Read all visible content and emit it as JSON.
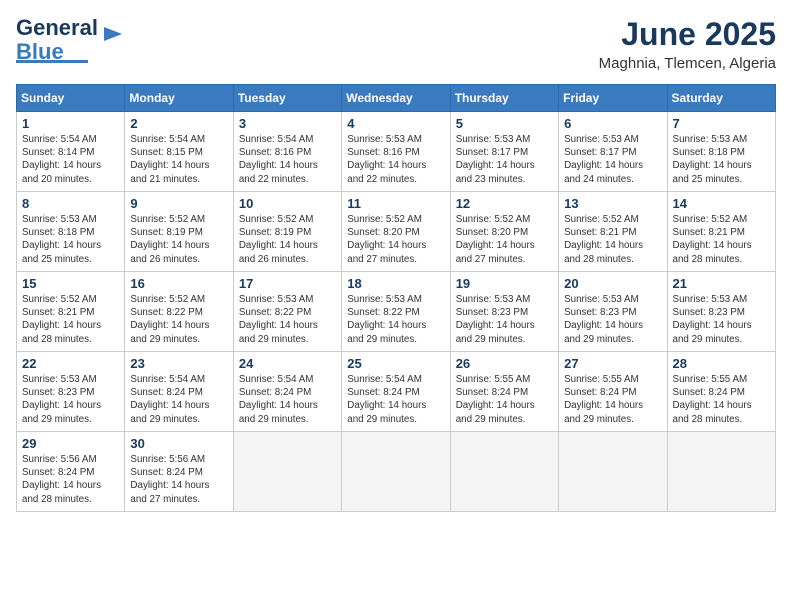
{
  "logo": {
    "line1": "General",
    "line2": "Blue"
  },
  "title": "June 2025",
  "location": "Maghnia, Tlemcen, Algeria",
  "headers": [
    "Sunday",
    "Monday",
    "Tuesday",
    "Wednesday",
    "Thursday",
    "Friday",
    "Saturday"
  ],
  "weeks": [
    [
      {
        "day": "1",
        "lines": [
          "Sunrise: 5:54 AM",
          "Sunset: 8:14 PM",
          "Daylight: 14 hours",
          "and 20 minutes."
        ]
      },
      {
        "day": "2",
        "lines": [
          "Sunrise: 5:54 AM",
          "Sunset: 8:15 PM",
          "Daylight: 14 hours",
          "and 21 minutes."
        ]
      },
      {
        "day": "3",
        "lines": [
          "Sunrise: 5:54 AM",
          "Sunset: 8:16 PM",
          "Daylight: 14 hours",
          "and 22 minutes."
        ]
      },
      {
        "day": "4",
        "lines": [
          "Sunrise: 5:53 AM",
          "Sunset: 8:16 PM",
          "Daylight: 14 hours",
          "and 22 minutes."
        ]
      },
      {
        "day": "5",
        "lines": [
          "Sunrise: 5:53 AM",
          "Sunset: 8:17 PM",
          "Daylight: 14 hours",
          "and 23 minutes."
        ]
      },
      {
        "day": "6",
        "lines": [
          "Sunrise: 5:53 AM",
          "Sunset: 8:17 PM",
          "Daylight: 14 hours",
          "and 24 minutes."
        ]
      },
      {
        "day": "7",
        "lines": [
          "Sunrise: 5:53 AM",
          "Sunset: 8:18 PM",
          "Daylight: 14 hours",
          "and 25 minutes."
        ]
      }
    ],
    [
      {
        "day": "8",
        "lines": [
          "Sunrise: 5:53 AM",
          "Sunset: 8:18 PM",
          "Daylight: 14 hours",
          "and 25 minutes."
        ]
      },
      {
        "day": "9",
        "lines": [
          "Sunrise: 5:52 AM",
          "Sunset: 8:19 PM",
          "Daylight: 14 hours",
          "and 26 minutes."
        ]
      },
      {
        "day": "10",
        "lines": [
          "Sunrise: 5:52 AM",
          "Sunset: 8:19 PM",
          "Daylight: 14 hours",
          "and 26 minutes."
        ]
      },
      {
        "day": "11",
        "lines": [
          "Sunrise: 5:52 AM",
          "Sunset: 8:20 PM",
          "Daylight: 14 hours",
          "and 27 minutes."
        ]
      },
      {
        "day": "12",
        "lines": [
          "Sunrise: 5:52 AM",
          "Sunset: 8:20 PM",
          "Daylight: 14 hours",
          "and 27 minutes."
        ]
      },
      {
        "day": "13",
        "lines": [
          "Sunrise: 5:52 AM",
          "Sunset: 8:21 PM",
          "Daylight: 14 hours",
          "and 28 minutes."
        ]
      },
      {
        "day": "14",
        "lines": [
          "Sunrise: 5:52 AM",
          "Sunset: 8:21 PM",
          "Daylight: 14 hours",
          "and 28 minutes."
        ]
      }
    ],
    [
      {
        "day": "15",
        "lines": [
          "Sunrise: 5:52 AM",
          "Sunset: 8:21 PM",
          "Daylight: 14 hours",
          "and 28 minutes."
        ]
      },
      {
        "day": "16",
        "lines": [
          "Sunrise: 5:52 AM",
          "Sunset: 8:22 PM",
          "Daylight: 14 hours",
          "and 29 minutes."
        ]
      },
      {
        "day": "17",
        "lines": [
          "Sunrise: 5:53 AM",
          "Sunset: 8:22 PM",
          "Daylight: 14 hours",
          "and 29 minutes."
        ]
      },
      {
        "day": "18",
        "lines": [
          "Sunrise: 5:53 AM",
          "Sunset: 8:22 PM",
          "Daylight: 14 hours",
          "and 29 minutes."
        ]
      },
      {
        "day": "19",
        "lines": [
          "Sunrise: 5:53 AM",
          "Sunset: 8:23 PM",
          "Daylight: 14 hours",
          "and 29 minutes."
        ]
      },
      {
        "day": "20",
        "lines": [
          "Sunrise: 5:53 AM",
          "Sunset: 8:23 PM",
          "Daylight: 14 hours",
          "and 29 minutes."
        ]
      },
      {
        "day": "21",
        "lines": [
          "Sunrise: 5:53 AM",
          "Sunset: 8:23 PM",
          "Daylight: 14 hours",
          "and 29 minutes."
        ]
      }
    ],
    [
      {
        "day": "22",
        "lines": [
          "Sunrise: 5:53 AM",
          "Sunset: 8:23 PM",
          "Daylight: 14 hours",
          "and 29 minutes."
        ]
      },
      {
        "day": "23",
        "lines": [
          "Sunrise: 5:54 AM",
          "Sunset: 8:24 PM",
          "Daylight: 14 hours",
          "and 29 minutes."
        ]
      },
      {
        "day": "24",
        "lines": [
          "Sunrise: 5:54 AM",
          "Sunset: 8:24 PM",
          "Daylight: 14 hours",
          "and 29 minutes."
        ]
      },
      {
        "day": "25",
        "lines": [
          "Sunrise: 5:54 AM",
          "Sunset: 8:24 PM",
          "Daylight: 14 hours",
          "and 29 minutes."
        ]
      },
      {
        "day": "26",
        "lines": [
          "Sunrise: 5:55 AM",
          "Sunset: 8:24 PM",
          "Daylight: 14 hours",
          "and 29 minutes."
        ]
      },
      {
        "day": "27",
        "lines": [
          "Sunrise: 5:55 AM",
          "Sunset: 8:24 PM",
          "Daylight: 14 hours",
          "and 29 minutes."
        ]
      },
      {
        "day": "28",
        "lines": [
          "Sunrise: 5:55 AM",
          "Sunset: 8:24 PM",
          "Daylight: 14 hours",
          "and 28 minutes."
        ]
      }
    ],
    [
      {
        "day": "29",
        "lines": [
          "Sunrise: 5:56 AM",
          "Sunset: 8:24 PM",
          "Daylight: 14 hours",
          "and 28 minutes."
        ]
      },
      {
        "day": "30",
        "lines": [
          "Sunrise: 5:56 AM",
          "Sunset: 8:24 PM",
          "Daylight: 14 hours",
          "and 27 minutes."
        ]
      },
      {
        "day": "",
        "lines": []
      },
      {
        "day": "",
        "lines": []
      },
      {
        "day": "",
        "lines": []
      },
      {
        "day": "",
        "lines": []
      },
      {
        "day": "",
        "lines": []
      }
    ]
  ]
}
